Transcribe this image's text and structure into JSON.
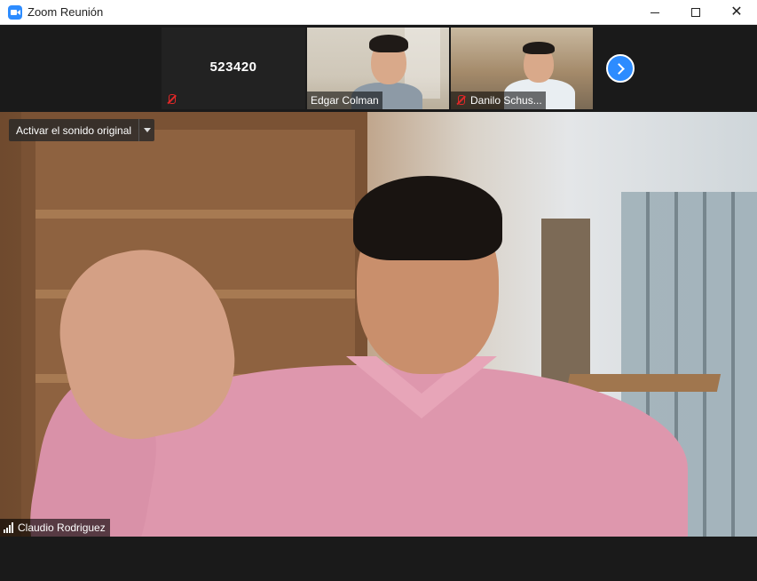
{
  "window": {
    "title": "Zoom Reunión"
  },
  "thumbnails": [
    {
      "display": "523420",
      "muted": true
    },
    {
      "name": "Edgar Colman",
      "muted": false
    },
    {
      "name": "Danilo Schus...",
      "muted": true
    }
  ],
  "main_video": {
    "audio_button_label": "Activar el sonido original",
    "speaker_name": "Claudio Rodriguez"
  },
  "icons": {
    "app": "zoom-camera-icon",
    "minimize": "minimize-icon",
    "maximize": "maximize-icon",
    "close": "close-icon",
    "next": "chevron-right-icon",
    "muted_mic": "mic-off-icon",
    "signal": "signal-strength-icon"
  },
  "colors": {
    "accent": "#2d8cff",
    "muted_red": "#e02828",
    "background": "#1a1a1a"
  }
}
